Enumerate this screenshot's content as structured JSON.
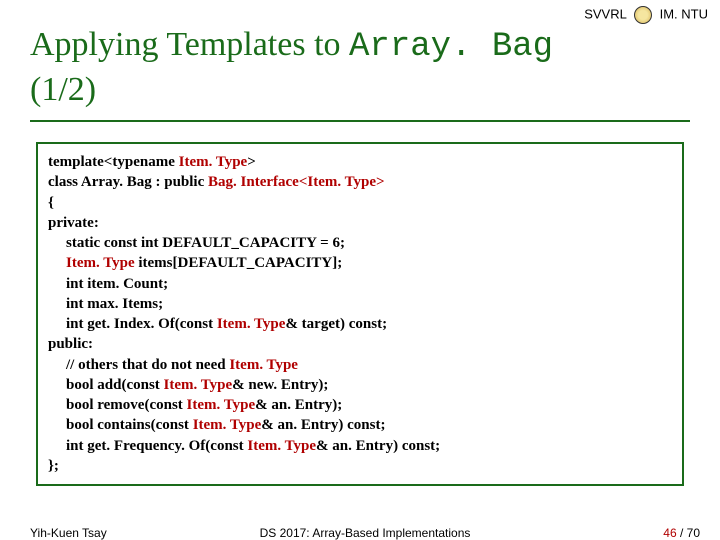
{
  "header": {
    "lab": "SVVRL",
    "org": "IM. NTU"
  },
  "title": {
    "prefix": "Applying Templates to ",
    "mono": "Array. Bag",
    "suffix": "(1/2)"
  },
  "code": {
    "l1a": "template<typename ",
    "l1b": ">",
    "l2a": "class Array. Bag : public ",
    "l2b": "Bag. Interface<",
    "l2c": ">",
    "l3": "{",
    "l4": "private:",
    "l5": "static const int DEFAULT_CAPACITY = 6;",
    "l6a": " items[DEFAULT_CAPACITY];",
    "l7": "int item. Count;",
    "l8": "int max. Items;",
    "l9a": "int get. Index. Of(const ",
    "l9b": "& target) const;",
    "l10": "public:",
    "l11a": "// others that do not need ",
    "l12a": "bool add(const ",
    "l12b": "& new. Entry);",
    "l13a": "bool remove(const ",
    "l13b": "& an. Entry);",
    "l14a": "bool contains(const ",
    "l14b": "& an. Entry) const;",
    "l15a": "int get. Frequency. Of(const ",
    "l15b": "& an. Entry) const;",
    "l16": "};",
    "itemtype": "Item. Type"
  },
  "footer": {
    "author": "Yih-Kuen Tsay",
    "course": "DS 2017: Array-Based Implementations",
    "page_cur": "46",
    "page_sep": " / ",
    "page_total": "70"
  }
}
